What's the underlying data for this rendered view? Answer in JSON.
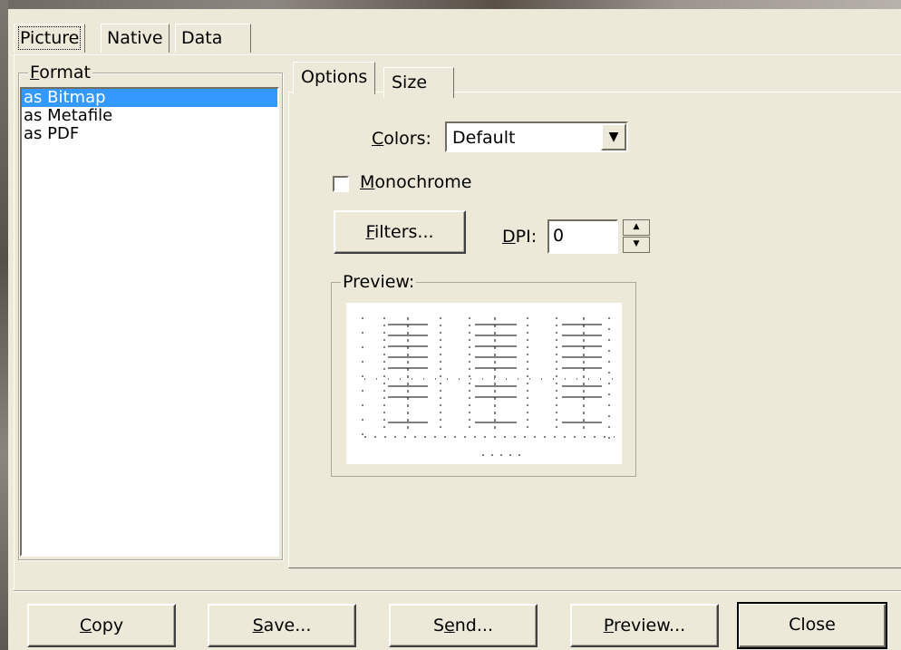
{
  "top_tabs": [
    "Picture",
    "Native",
    "Data"
  ],
  "format": {
    "legend": "Format",
    "legend_mnemonic": "F",
    "legend_rest": "ormat",
    "items": [
      "as Bitmap",
      "as Metafile",
      "as PDF"
    ],
    "selected": "as Bitmap"
  },
  "inner_tabs": [
    "Options",
    "Size"
  ],
  "options": {
    "colors_label_mn": "C",
    "colors_label_rest": "olors:",
    "colors_value": "Default",
    "monochrome_mn": "M",
    "monochrome_rest": "onochrome",
    "monochrome_checked": false,
    "filters_mn": "F",
    "filters_rest": "ilters...",
    "dpi_label_mn": "D",
    "dpi_label_rest": "PI:",
    "dpi_value": "0",
    "preview_legend": "Preview:"
  },
  "buttons": {
    "copy_mn": "C",
    "copy_rest": "opy",
    "save_mn": "S",
    "save_rest": "ave...",
    "send_pre": "S",
    "send_mn": "e",
    "send_rest": "nd...",
    "preview_mn": "P",
    "preview_rest": "review...",
    "close": "Close"
  },
  "colors": {
    "selection": "#3399ff",
    "face": "#ece9d8"
  }
}
